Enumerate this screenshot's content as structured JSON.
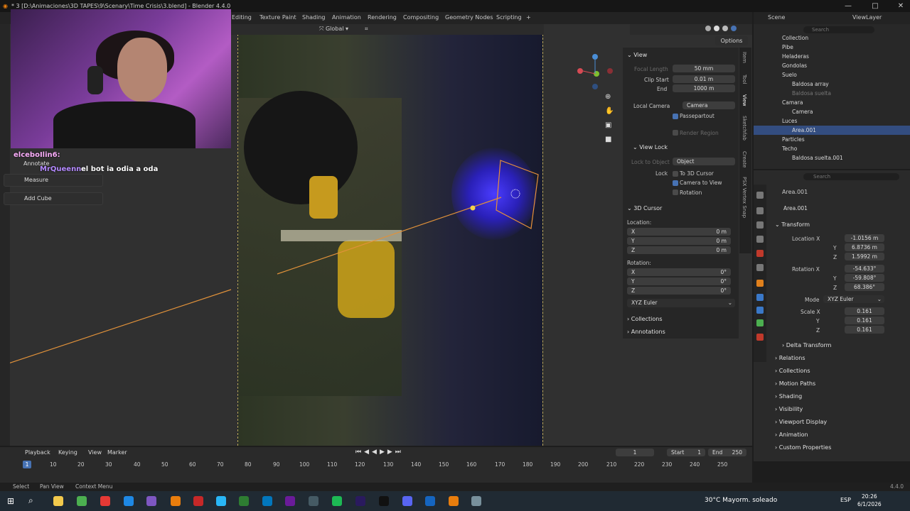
{
  "window": {
    "title": "* 3 [D:\\Animaciones\\3D TAPES\\9\\Scenary\\Time Crisis\\3.blend] - Blender 4.4.0",
    "minimize": "—",
    "maximize": "□",
    "close": "✕"
  },
  "workspaces": [
    "Editing",
    "Texture Paint",
    "Shading",
    "Animation",
    "Rendering",
    "Compositing",
    "Geometry Nodes",
    "Scripting",
    "+"
  ],
  "scene": {
    "label": "Scene",
    "viewlayer": "ViewLayer"
  },
  "viewport_header": {
    "orientation": "Global",
    "options": "Options"
  },
  "stream_chat": [
    {
      "user": "elceboIlin6:",
      "text": ""
    },
    {
      "user": "MrQueenn:",
      "text": "el bot ia odia a oda"
    }
  ],
  "tools": {
    "annotate": "Annotate",
    "measure": "Measure",
    "add_cube": "Add Cube"
  },
  "npanel": {
    "view_header": "View",
    "focal_length_label": "Focal Length",
    "focal_length": "50 mm",
    "clip_start_label": "Clip Start",
    "clip_start": "0.01 m",
    "end_label": "End",
    "end": "1000 m",
    "local_camera_label": "Local Camera",
    "local_camera": "Camera",
    "passepartout": "Passepartout",
    "render_region": "Render Region",
    "view_lock_header": "View Lock",
    "lock_to_object_label": "Lock to Object",
    "lock_to_object": "Object",
    "lock_label": "Lock",
    "to_3d_cursor": "To 3D Cursor",
    "camera_to_view": "Camera to View",
    "rotation": "Rotation",
    "cursor_header": "3D Cursor",
    "location_label": "Location:",
    "loc_x": "0 m",
    "loc_y": "0 m",
    "loc_z": "0 m",
    "rotation_label": "Rotation:",
    "rot_x": "0°",
    "rot_y": "0°",
    "rot_z": "0°",
    "rotation_mode": "XYZ Euler",
    "collections": "Collections",
    "annotations": "Annotations",
    "x": "X",
    "y": "Y",
    "z": "Z"
  },
  "side_tabs": [
    "Item",
    "Tool",
    "View",
    "Sketchfab",
    "Create",
    "PSX Vertex Snap"
  ],
  "outliner": {
    "search_placeholder": "Search",
    "rows": [
      "Collection",
      "Pibe",
      "Heladeras",
      "Gondolas",
      "Suelo",
      "Baldosa array",
      "Baldosa suelta",
      "Camara",
      "Camera",
      "Luces",
      "Area.001",
      "Particles",
      "Techo",
      "Baldosa suelta.001"
    ]
  },
  "properties": {
    "search_placeholder": "Search",
    "object_name": "Area.001",
    "datablock": "Area.001",
    "transform": "Transform",
    "location_x_label": "Location X",
    "location_x": "-1.0156 m",
    "location_y": "6.8736 m",
    "location_z": "1.5992 m",
    "rotation_x_label": "Rotation X",
    "rotation_x": "-54.633°",
    "rotation_y": "-59.808°",
    "rotation_z": "68.386°",
    "mode_label": "Mode",
    "mode": "XYZ Euler",
    "scale_x_label": "Scale X",
    "scale_x": "0.161",
    "scale_y": "0.161",
    "scale_z": "0.161",
    "y": "Y",
    "z": "Z",
    "delta_transform": "Delta Transform",
    "panels": [
      "Relations",
      "Collections",
      "Motion Paths",
      "Shading",
      "Visibility",
      "Viewport Display",
      "Animation",
      "Custom Properties"
    ]
  },
  "timeline": {
    "playback": "Playback",
    "keying": "Keying",
    "view": "View",
    "marker": "Marker",
    "current_frame": "1",
    "start_label": "Start",
    "start": "1",
    "end_label": "End",
    "end": "250",
    "ticks": [
      "10",
      "20",
      "30",
      "40",
      "50",
      "60",
      "70",
      "80",
      "90",
      "100",
      "110",
      "120",
      "130",
      "140",
      "150",
      "160",
      "170",
      "180",
      "190",
      "200",
      "210",
      "220",
      "230",
      "240",
      "250"
    ],
    "playhead": "1"
  },
  "statusbar": {
    "select": "Select",
    "pan_view": "Pan View",
    "context_menu": "Context Menu",
    "version": "4.4.0"
  },
  "taskbar": {
    "weather": "30°C  Mayorm. soleado",
    "lang": "ESP",
    "time": "20:26",
    "date": "6/1/2026"
  }
}
